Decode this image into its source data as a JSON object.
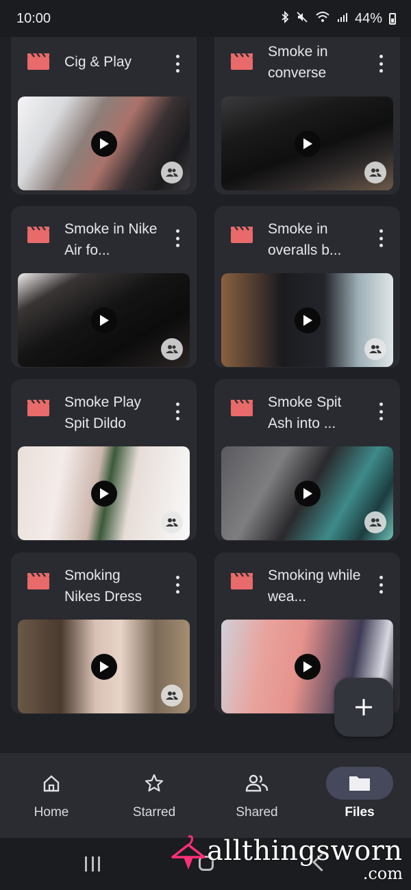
{
  "status_bar": {
    "time": "10:00",
    "battery_text": "44%",
    "icons": [
      "bluetooth-icon",
      "mute-icon",
      "wifi-icon",
      "signal-icon",
      "battery-icon"
    ]
  },
  "files": [
    {
      "title": "Cig & Play",
      "type": "video",
      "shared": true
    },
    {
      "title": "Smoke in converse",
      "type": "video",
      "shared": true
    },
    {
      "title": "Smoke in Nike Air fo...",
      "type": "video",
      "shared": true
    },
    {
      "title": "Smoke in overalls b...",
      "type": "video",
      "shared": true
    },
    {
      "title": "Smoke Play Spit Dildo",
      "type": "video",
      "shared": true
    },
    {
      "title": "Smoke Spit Ash into  ...",
      "type": "video",
      "shared": true
    },
    {
      "title": "Smoking Nikes Dress",
      "type": "video",
      "shared": true
    },
    {
      "title": "Smoking while wea...",
      "type": "video",
      "shared": true
    }
  ],
  "fab": {
    "icon": "plus-icon"
  },
  "bottom_nav": {
    "items": [
      {
        "label": "Home",
        "icon": "home-icon"
      },
      {
        "label": "Starred",
        "icon": "star-icon"
      },
      {
        "label": "Shared",
        "icon": "shared-people-icon"
      },
      {
        "label": "Files",
        "icon": "folder-icon",
        "active": true
      }
    ]
  },
  "watermark": {
    "text": "allthingsworn",
    "suffix": ".com"
  },
  "colors": {
    "accent_red": "#e86a6a",
    "active_pill": "#45495b",
    "card_bg": "#2a2b30",
    "page_bg": "#1f2025"
  }
}
